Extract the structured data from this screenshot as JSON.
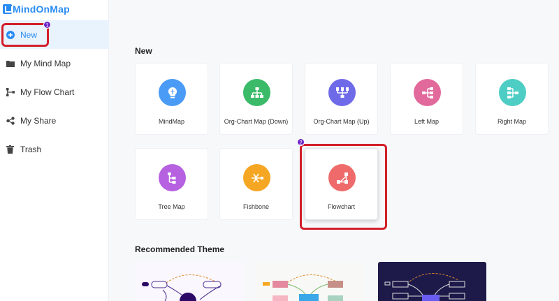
{
  "app": {
    "brand": "MindOnMap"
  },
  "sidebar": {
    "items": [
      {
        "label": "New",
        "icon": "plus-circle-icon"
      },
      {
        "label": "My Mind Map",
        "icon": "folder-icon"
      },
      {
        "label": "My Flow Chart",
        "icon": "flowchart-icon"
      },
      {
        "label": "My Share",
        "icon": "share-icon"
      },
      {
        "label": "Trash",
        "icon": "trash-icon"
      }
    ]
  },
  "annotations": {
    "step1": "1",
    "step2": "2",
    "highlight_color": "#d21f2a",
    "badge_color": "#6a22c5"
  },
  "main": {
    "new_title": "New",
    "templates": [
      {
        "label": "MindMap",
        "color": "#4a9bf5",
        "icon": "lightbulb-icon"
      },
      {
        "label": "Org-Chart Map (Down)",
        "color": "#3bbb6a",
        "icon": "org-chart-down-icon"
      },
      {
        "label": "Org-Chart Map (Up)",
        "color": "#6f6ae8",
        "icon": "org-chart-up-icon"
      },
      {
        "label": "Left Map",
        "color": "#e2699c",
        "icon": "left-map-icon"
      },
      {
        "label": "Right Map",
        "color": "#4ecdc4",
        "icon": "right-map-icon"
      },
      {
        "label": "Tree Map",
        "color": "#b561e0",
        "icon": "tree-map-icon"
      },
      {
        "label": "Fishbone",
        "color": "#f5a623",
        "icon": "fishbone-icon"
      },
      {
        "label": "Flowchart",
        "color": "#ef6b6b",
        "icon": "flowchart-icon"
      }
    ],
    "recommended_title": "Recommended Theme",
    "accent": "#2a8cf2"
  }
}
